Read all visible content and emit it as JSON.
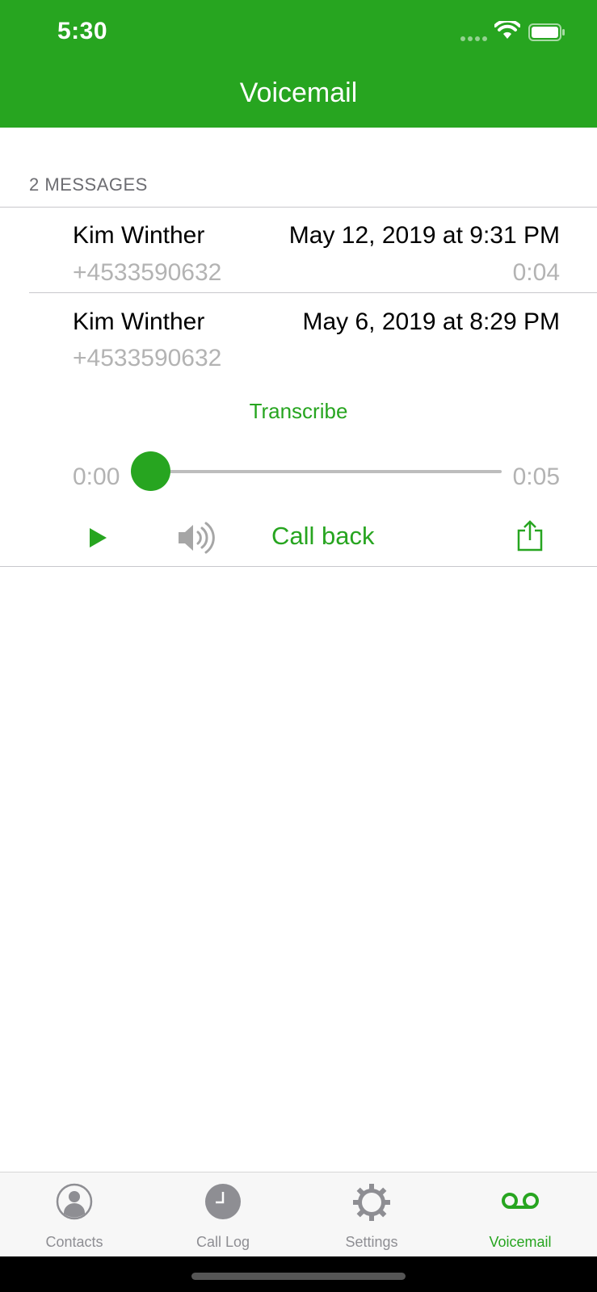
{
  "status_bar": {
    "time": "5:30"
  },
  "header": {
    "title": "Voicemail"
  },
  "section": {
    "header": "2 MESSAGES"
  },
  "messages": [
    {
      "name": "Kim Winther",
      "date": "May 12, 2019 at 9:31 PM",
      "number": "+4533590632",
      "duration": "0:04"
    },
    {
      "name": "Kim Winther",
      "date": "May 6, 2019 at 8:29 PM",
      "number": "+4533590632"
    }
  ],
  "player": {
    "transcribe_label": "Transcribe",
    "elapsed": "0:00",
    "total": "0:05",
    "progress": 0,
    "callback_label": "Call back"
  },
  "tabs": [
    {
      "label": "Contacts",
      "icon": "contacts-icon",
      "active": false
    },
    {
      "label": "Call Log",
      "icon": "clock-icon",
      "active": false
    },
    {
      "label": "Settings",
      "icon": "gear-icon",
      "active": false
    },
    {
      "label": "Voicemail",
      "icon": "voicemail-icon",
      "active": true
    }
  ],
  "colors": {
    "accent": "#27a520",
    "secondary_text": "#b3b3b3",
    "inactive_tab": "#8e8e93"
  }
}
